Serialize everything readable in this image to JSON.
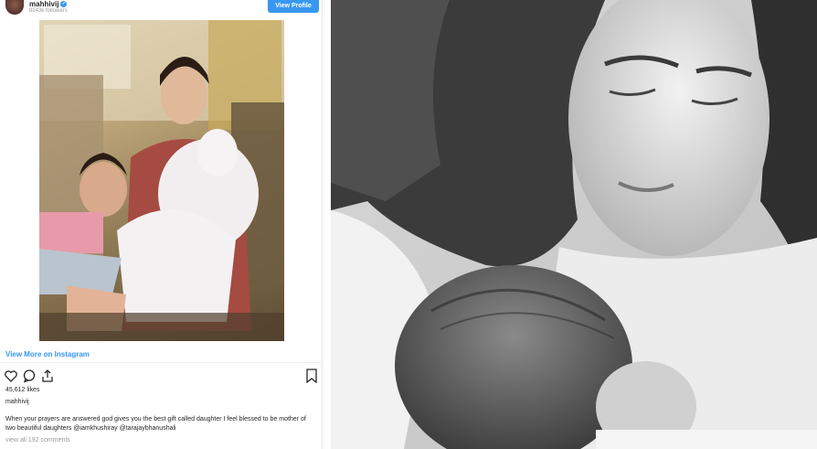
{
  "post": {
    "username": "mahhivij",
    "followers": "8243k followers",
    "view_profile_label": "View Profile",
    "view_more_label": "View More on Instagram",
    "likes": "45,612 likes",
    "owner": "mahhivij",
    "caption": "When your prayers are answered god gives you the best gift called daughter I feel blessed to be mother of two beautiful daughters @iamkhushiray @tarajaybhanushali",
    "comments_label": "view all 192 comments"
  },
  "icons": {
    "like": "heart-icon",
    "comment": "comment-icon",
    "share": "share-icon",
    "save": "bookmark-icon",
    "verified": "verified-badge-icon"
  },
  "colors": {
    "accent": "#3897f0",
    "text": "#262626",
    "muted": "#999999"
  }
}
